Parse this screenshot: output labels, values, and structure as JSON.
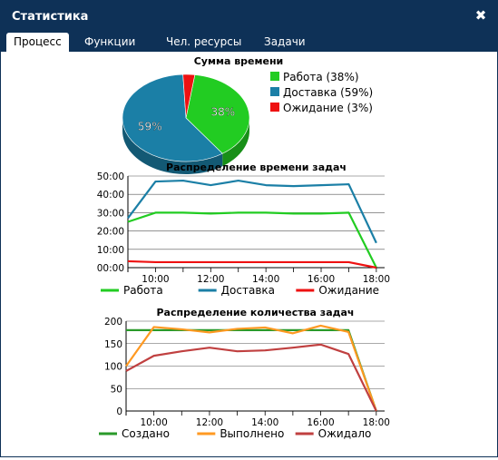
{
  "window": {
    "title": "Статистика",
    "close_icon": "close-icon"
  },
  "tabs": [
    {
      "label": "Процесс",
      "active": true
    },
    {
      "label": "Функции",
      "active": false
    },
    {
      "label": "Чел. ресурсы",
      "active": false
    },
    {
      "label": "Задачи",
      "active": false
    }
  ],
  "colors": {
    "titlebar": "#0e3157",
    "green": "#2ecc2e",
    "blue": "#1e7fa8",
    "red": "#ee2222",
    "dark_green": "#2a9a2a",
    "orange": "#ff9922",
    "brick": "#c04040"
  },
  "chart_data": [
    {
      "type": "pie",
      "title": "Сумма времени",
      "labels": [
        "Работа (38%)",
        "Доставка (59%)",
        "Ожидание (3%)"
      ],
      "values": [
        38,
        59,
        3
      ],
      "slice_labels": [
        "38%",
        "59%",
        ""
      ],
      "colors": [
        "#22cc22",
        "#1b7fa6",
        "#ee1111"
      ],
      "legend": "right"
    },
    {
      "type": "line",
      "title": "Распределение времени задач",
      "xlabel": "",
      "ylabel": "",
      "x": [
        9,
        10,
        11,
        12,
        13,
        14,
        15,
        16,
        17,
        18
      ],
      "x_ticks": [
        "10:00",
        "12:00",
        "14:00",
        "16:00",
        "18:00"
      ],
      "x_tick_values": [
        10,
        12,
        14,
        16,
        18
      ],
      "xlim": [
        9,
        18.3
      ],
      "y_ticks": [
        "00:00",
        "10:00",
        "20:00",
        "30:00",
        "40:00",
        "50:00"
      ],
      "ylim": [
        0,
        50
      ],
      "grid": true,
      "legend": "bottom",
      "series": [
        {
          "name": "Работа",
          "color": "#22cc22",
          "values": [
            25,
            30,
            30,
            29.5,
            30,
            30,
            29.5,
            29.5,
            30,
            0
          ]
        },
        {
          "name": "Доставка",
          "color": "#1b7fa6",
          "values": [
            27,
            47,
            47.5,
            45,
            47.5,
            45,
            44.5,
            45,
            45.5,
            13.5
          ]
        },
        {
          "name": "Ожидание",
          "color": "#ee1111",
          "values": [
            3.5,
            3,
            3,
            3,
            3,
            3,
            3,
            3,
            3,
            0
          ]
        }
      ]
    },
    {
      "type": "line",
      "title": "Распределение количества задач",
      "xlabel": "",
      "ylabel": "",
      "x": [
        9,
        10,
        11,
        12,
        13,
        14,
        15,
        16,
        17,
        18
      ],
      "x_ticks": [
        "10:00",
        "12:00",
        "14:00",
        "16:00",
        "18:00"
      ],
      "x_tick_values": [
        10,
        12,
        14,
        16,
        18
      ],
      "xlim": [
        9,
        18.3
      ],
      "y_ticks": [
        "0",
        "50",
        "100",
        "150",
        "200"
      ],
      "ylim": [
        0,
        200
      ],
      "grid": true,
      "legend": "bottom",
      "series": [
        {
          "name": "Создано",
          "color": "#2a9a2a",
          "values": [
            180,
            180,
            180,
            180,
            180,
            180,
            180,
            180,
            180,
            0
          ]
        },
        {
          "name": "Выполнено",
          "color": "#ff9922",
          "values": [
            100,
            187,
            182,
            175,
            183,
            186,
            173,
            190,
            176,
            0
          ]
        },
        {
          "name": "Ожидало",
          "color": "#c04040",
          "values": [
            89,
            123,
            133,
            141,
            133,
            135,
            141,
            148,
            127,
            0
          ]
        }
      ]
    }
  ]
}
